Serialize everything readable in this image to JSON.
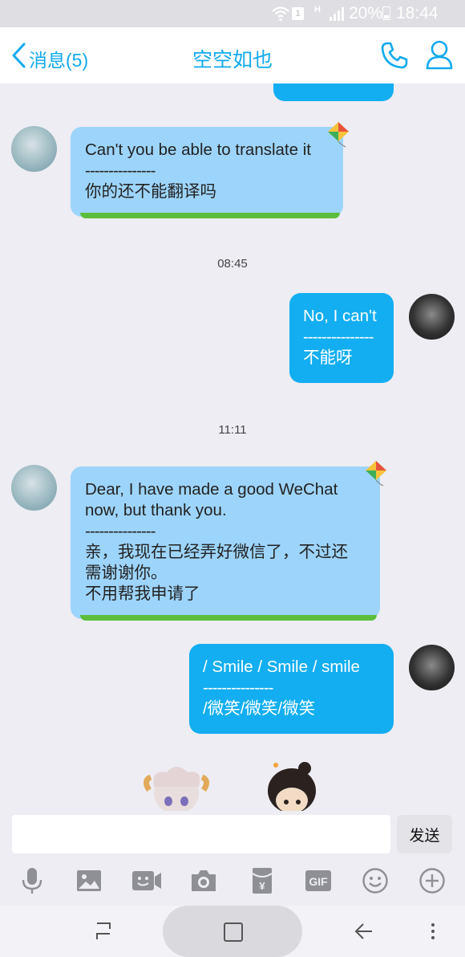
{
  "status_bar": {
    "sim_label": "1",
    "network_label": "H",
    "battery_percent": "20%",
    "time": "18:44"
  },
  "header": {
    "back_label": "消息(5)",
    "title": "空空如也"
  },
  "messages": [
    {
      "side": "incoming",
      "lines": [
        "Can't you be able to translate it",
        "---------------",
        "你的还不能翻译吗"
      ]
    },
    {
      "type": "timestamp",
      "text": "08:45"
    },
    {
      "side": "outgoing",
      "lines": [
        "No, I can't",
        "---------------",
        "不能呀"
      ]
    },
    {
      "type": "timestamp",
      "text": "11:11"
    },
    {
      "side": "incoming",
      "lines": [
        "Dear, I have made a good WeChat",
        "now, but thank you.",
        "---------------",
        "亲，我现在已经弄好微信了，不过还",
        "需谢谢你。",
        "不用帮我申请了"
      ]
    },
    {
      "side": "outgoing",
      "lines": [
        "/ Smile / Smile / smile",
        "---------------",
        "/微笑/微笑/微笑"
      ]
    }
  ],
  "input": {
    "placeholder": "",
    "send_label": "发送"
  },
  "toolbar": {
    "items": [
      "microphone-icon",
      "image-icon",
      "video-call-icon",
      "camera-icon",
      "red-packet-icon",
      "gif-icon",
      "emoji-icon",
      "plus-icon"
    ],
    "gif_label": "GIF"
  },
  "colors": {
    "accent": "#12aaee",
    "outgoing_bubble": "#12aef1",
    "incoming_bubble": "#9dd4fb",
    "background": "#ededf3"
  }
}
